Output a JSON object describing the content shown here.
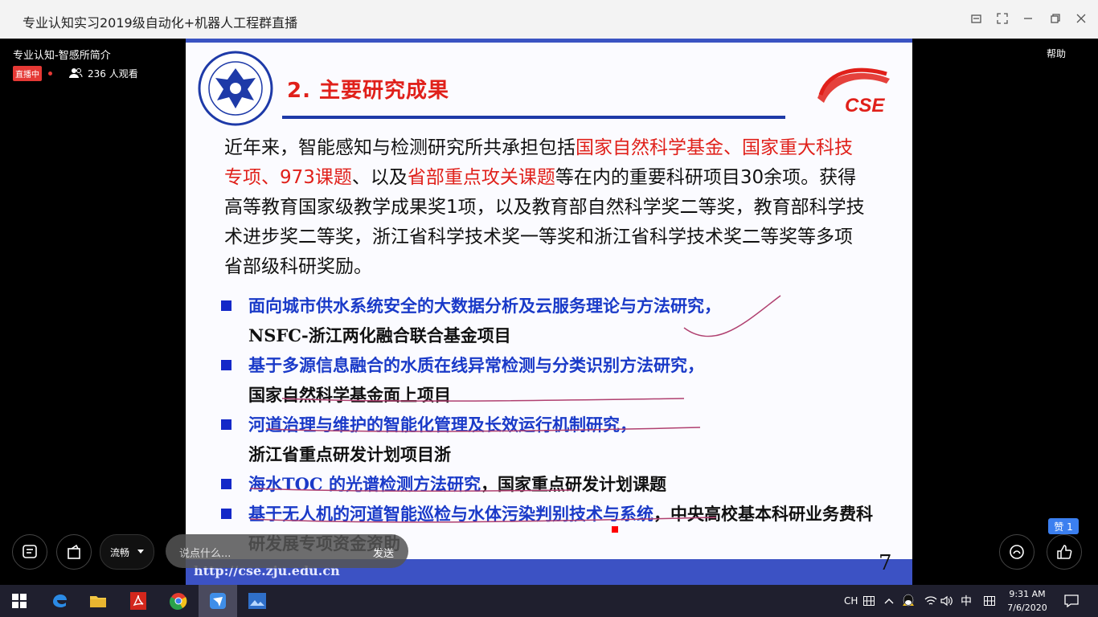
{
  "window": {
    "title": "专业认知实习2019级自动化+机器人工程群直播"
  },
  "stream": {
    "title": "专业认知-智感所简介",
    "help_label": "帮助",
    "live_badge": "直播中",
    "viewers": "236 人观看"
  },
  "slide": {
    "heading": "2.  主要研究成果",
    "logo_text": "CSE",
    "paragraph": {
      "p1": "近年来，智能感知与检测研究所共承担包括",
      "r1": "国家自然科学基金、国家重大科技专项、973课题",
      "p2": "、以及",
      "r2": "省部重点攻关课题",
      "p3": "等在内的重要科研项目30余项。获得高等教育国家级教学成果奖1项，以及教育部自然科学奖二等奖，教育部科学技术进步奖二等奖，浙江省科学技术奖一等奖和浙江省科学技术奖二等奖等多项省部级科研奖励。"
    },
    "bullets": [
      {
        "blue": "面向城市供水系统安全的大数据分析及云服务理论与方法研究，",
        "black": "NSFC-浙江两化融合联合基金项目"
      },
      {
        "blue": "基于多源信息融合的水质在线异常检测与分类识别方法研究，",
        "black": "国家自然科学基金面上项目"
      },
      {
        "blue": "河道治理与维护的智能化管理及长效运行机制研究，",
        "black": "浙江省重点研发计划项目浙"
      },
      {
        "blue": "海水TOC 的光谱检测方法研究",
        "black": "，国家重点研发计划课题"
      },
      {
        "blue": "基于无人机的河道智能巡检与水体污染判别技术与系统",
        "black": "，中央高校基本科研业务费科研发展专项资金资助"
      }
    ],
    "url": "http://cse.zju.edu.cn",
    "page_number": "7"
  },
  "controls": {
    "quality_label": "流畅",
    "chat_placeholder": "说点什么...",
    "send_label": "发送",
    "like_count": "赞 1"
  },
  "taskbar": {
    "lang": "CH",
    "ime": "中",
    "time": "9:31 AM",
    "date": "7/6/2020"
  }
}
